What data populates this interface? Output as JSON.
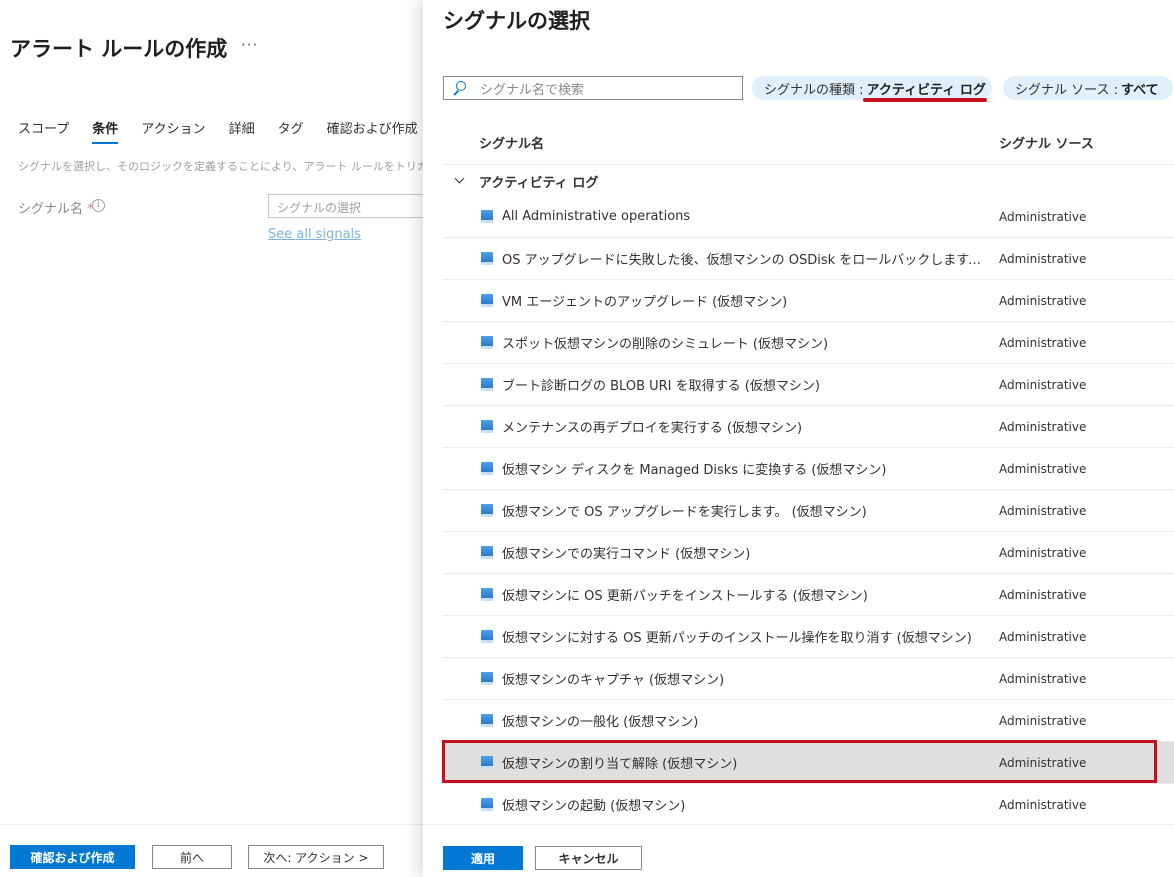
{
  "left": {
    "title": "アラート ルールの作成",
    "more": "···",
    "tabs": [
      "スコープ",
      "条件",
      "アクション",
      "詳細",
      "タグ",
      "確認および作成"
    ],
    "active_tab": "条件",
    "description": "シグナルを選択し、そのロジックを定義することにより、アラート ルールをトリガーする",
    "signal_label": "シグナル名",
    "required_mark": "*",
    "info_icon": "i",
    "signal_placeholder": "シグナルの選択",
    "see_all_link": "See all signals",
    "footer": {
      "review_create": "確認および作成",
      "previous": "前へ",
      "next": "次へ: アクション >"
    }
  },
  "panel": {
    "title": "シグナルの選択",
    "search_placeholder": "シグナル名で検索",
    "filter_type": {
      "label": "シグナルの種類 :",
      "value": "アクティビティ ログ"
    },
    "filter_source": {
      "label": "シグナル ソース :",
      "value": "すべて"
    },
    "columns": {
      "name": "シグナル名",
      "source": "シグナル ソース"
    },
    "group": "アクティビティ ログ",
    "rows": [
      {
        "name": "All Administrative operations",
        "source": "Administrative"
      },
      {
        "name": "OS アップグレードに失敗した後、仮想マシンの OSDisk をロールバックします。 (...",
        "source": "Administrative"
      },
      {
        "name": "VM エージェントのアップグレード (仮想マシン)",
        "source": "Administrative"
      },
      {
        "name": "スポット仮想マシンの削除のシミュレート (仮想マシン)",
        "source": "Administrative"
      },
      {
        "name": "ブート診断ログの BLOB URI を取得する (仮想マシン)",
        "source": "Administrative"
      },
      {
        "name": "メンテナンスの再デプロイを実行する (仮想マシン)",
        "source": "Administrative"
      },
      {
        "name": "仮想マシン ディスクを Managed Disks に変換する (仮想マシン)",
        "source": "Administrative"
      },
      {
        "name": "仮想マシンで OS アップグレードを実行します。 (仮想マシン)",
        "source": "Administrative"
      },
      {
        "name": "仮想マシンでの実行コマンド (仮想マシン)",
        "source": "Administrative"
      },
      {
        "name": "仮想マシンに OS 更新パッチをインストールする (仮想マシン)",
        "source": "Administrative"
      },
      {
        "name": "仮想マシンに対する OS 更新パッチのインストール操作を取り消す (仮想マシン)",
        "source": "Administrative"
      },
      {
        "name": "仮想マシンのキャプチャ (仮想マシン)",
        "source": "Administrative"
      },
      {
        "name": "仮想マシンの一般化 (仮想マシン)",
        "source": "Administrative"
      },
      {
        "name": "仮想マシンの割り当て解除 (仮想マシン)",
        "source": "Administrative"
      },
      {
        "name": "仮想マシンの起動 (仮想マシン)",
        "source": "Administrative"
      }
    ],
    "selected_row": "仮想マシンの割り当て解除 (仮想マシン)",
    "footer": {
      "apply": "適用",
      "cancel": "キャンセル"
    }
  },
  "colors": {
    "accent": "#0078d4",
    "highlight": "#c50f1f",
    "pill_bg": "#e1effa",
    "selected_row": "#e1dfdd"
  }
}
